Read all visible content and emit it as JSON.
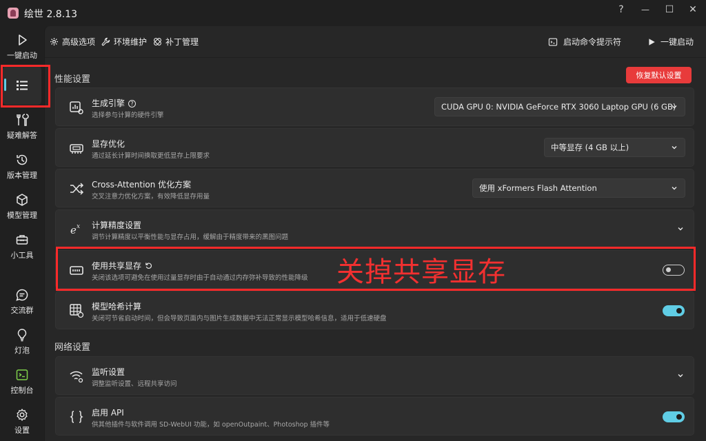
{
  "app": {
    "title": "绘世 2.8.13"
  },
  "window_controls": {
    "help": "?",
    "minimize": "—",
    "maximize": "☐",
    "close": "✕"
  },
  "sidebar": {
    "items": [
      {
        "label": "一键启动"
      },
      {
        "label": ""
      },
      {
        "label": "疑难解答"
      },
      {
        "label": "版本管理"
      },
      {
        "label": "模型管理"
      },
      {
        "label": "小工具"
      },
      {
        "label": "交流群"
      },
      {
        "label": "灯泡"
      },
      {
        "label": "控制台"
      },
      {
        "label": "设置"
      }
    ]
  },
  "tabs": {
    "advanced": "高级选项",
    "environment": "环境维护",
    "patch": "补丁管理",
    "cmd_prompt": "启动命令提示符",
    "one_click": "一键启动"
  },
  "performance": {
    "section_title": "性能设置",
    "reset_label": "恢复默认设置",
    "engine": {
      "title": "生成引擎",
      "desc": "选择参与计算的硬件引擎",
      "value": "CUDA GPU 0: NVIDIA GeForce RTX 3060 Laptop GPU (6 GB)"
    },
    "vram": {
      "title": "显存优化",
      "desc": "通过延长计算时间换取更低显存上限要求",
      "value": "中等显存 (4 GB 以上)"
    },
    "cross_attention": {
      "title": "Cross-Attention 优化方案",
      "desc": "交叉注意力优化方案，有效降低显存用量",
      "value": "使用 xFormers Flash Attention"
    },
    "precision": {
      "title": "计算精度设置",
      "desc": "调节计算精度以平衡性能与显存占用，缓解由于精度带来的黑图问题"
    },
    "shared_memory": {
      "title": "使用共享显存",
      "desc": "关闭该选项可避免在使用过量显存时由于自动通过内存弥补导致的性能降级",
      "enabled": false
    },
    "model_hash": {
      "title": "模型哈希计算",
      "desc": "关闭可节省启动时间，但会导致页面内与图片生成数据中无法正常显示模型哈希信息，适用于低速硬盘",
      "enabled": true
    }
  },
  "network": {
    "section_title": "网络设置",
    "listen": {
      "title": "监听设置",
      "desc": "调整监听设置、远程共享访问"
    },
    "api": {
      "title": "启用 API",
      "desc": "供其他插件与软件调用 SD-WebUI 功能，如 openOutpaint、Photoshop 插件等",
      "enabled": true
    }
  },
  "annotation": {
    "text": "关掉共享显存"
  },
  "colors": {
    "accent": "#60cde5",
    "danger": "#e83b3b",
    "highlight": "#ff2a2a"
  }
}
